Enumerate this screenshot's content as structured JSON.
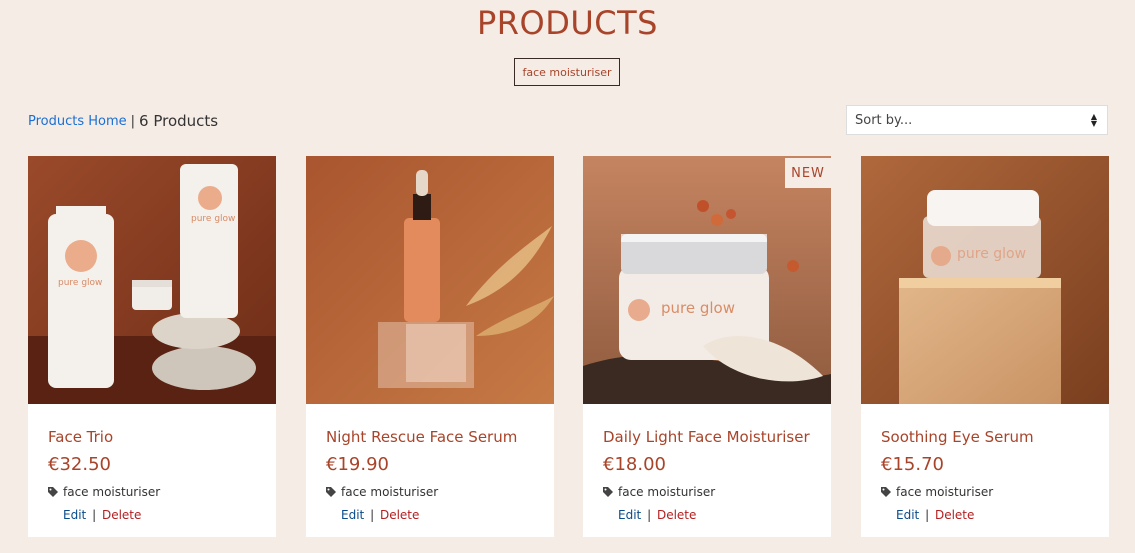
{
  "header": {
    "title": "PRODUCTS",
    "active_category": "face moisturiser"
  },
  "toolbar": {
    "home_link": "Products Home",
    "separator": "|",
    "count_text": "6 Products",
    "sort_label": "Sort by..."
  },
  "products": [
    {
      "name": "Face Trio",
      "price": "€32.50",
      "category": "face moisturiser",
      "edit": "Edit",
      "delete": "Delete",
      "badge": ""
    },
    {
      "name": "Night Rescue Face Serum",
      "price": "€19.90",
      "category": "face moisturiser",
      "edit": "Edit",
      "delete": "Delete",
      "badge": ""
    },
    {
      "name": "Daily Light Face Moisturiser",
      "price": "€18.00",
      "category": "face moisturiser",
      "edit": "Edit",
      "delete": "Delete",
      "badge": "NEW"
    },
    {
      "name": "Soothing Eye Serum",
      "price": "€15.70",
      "category": "face moisturiser",
      "edit": "Edit",
      "delete": "Delete",
      "badge": ""
    }
  ],
  "image_text": {
    "brand": "pure glow"
  },
  "colors": {
    "background": "#f6ece6",
    "accent": "#a8442a",
    "link": "#1a6fd4",
    "edit": "#0b4c8a",
    "delete": "#b21f1f"
  }
}
